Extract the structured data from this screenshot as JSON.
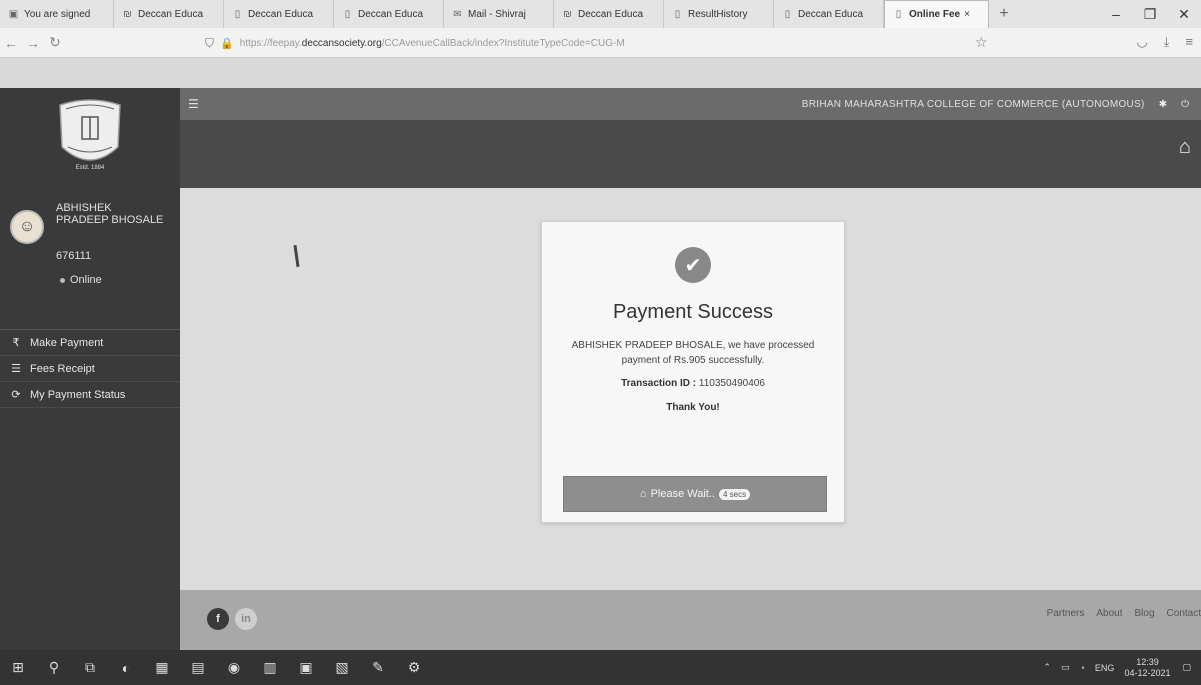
{
  "browser": {
    "tabs": [
      {
        "label": "You are signed",
        "icon": "▣",
        "active": false
      },
      {
        "label": "Deccan Educa",
        "icon": "₪",
        "active": false
      },
      {
        "label": "Deccan Educa",
        "icon": "▯",
        "active": false
      },
      {
        "label": "Deccan Educa",
        "icon": "▯",
        "active": false
      },
      {
        "label": "Mail - Shivraj",
        "icon": "✉",
        "active": false
      },
      {
        "label": "Deccan Educa",
        "icon": "₪",
        "active": false
      },
      {
        "label": "ResultHistory",
        "icon": "▯",
        "active": false
      },
      {
        "label": "Deccan Educa",
        "icon": "▯",
        "active": false
      },
      {
        "label": "Online Fee",
        "icon": "▯",
        "active": true
      }
    ],
    "url_prefix": "https://feepay.",
    "url_domain": "deccansociety.org",
    "url_path": "/CCAvenueCallBack/index?InstituteTypeCode=CUG-M"
  },
  "header": {
    "college_name": "BRIHAN MAHARASHTRA COLLEGE OF COMMERCE (AUTONOMOUS)"
  },
  "sidebar": {
    "logo_text": "Estd. 1884",
    "user_name": "ABHISHEK PRADEEP BHOSALE",
    "user_id": "676111",
    "status": "Online",
    "menu": [
      {
        "label": "Make Payment",
        "icon": "₹"
      },
      {
        "label": "Fees Receipt",
        "icon": "☰"
      },
      {
        "label": "My Payment Status",
        "icon": "⟳"
      }
    ]
  },
  "payment": {
    "title": "Payment Success",
    "message": "ABHISHEK PRADEEP BHOSALE, we have processed payment of Rs.905 successfully.",
    "transaction_label": "Transaction ID :",
    "transaction_id": "110350490406",
    "thanks": "Thank You!",
    "wait_label": "Please Wait..",
    "countdown": "4 secs"
  },
  "footer": {
    "links": [
      "Partners",
      "About",
      "Blog",
      "Contact"
    ]
  },
  "taskbar": {
    "language": "ENG",
    "time": "12:39",
    "date": "04-12-2021"
  },
  "colors": {
    "sidebar_bg": "#3a3a3a",
    "header_bg": "#6b6b6b",
    "subbar_bg": "#4a4a4a",
    "button_bg": "#8e8e8e"
  }
}
